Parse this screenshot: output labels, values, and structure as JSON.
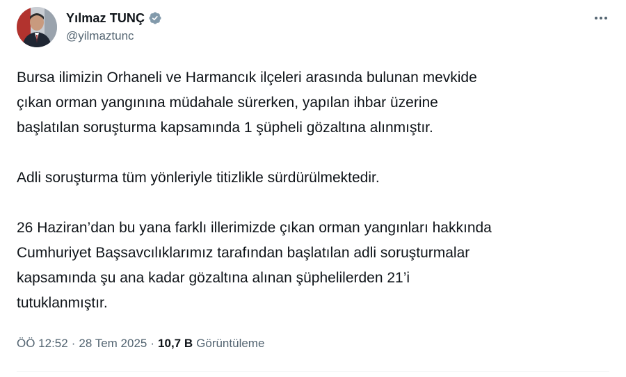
{
  "author": {
    "display_name": "Yılmaz TUNÇ",
    "handle": "@yilmaztunc",
    "verified_icon": "verified-badge-icon",
    "badge_color": "#829aab"
  },
  "menu": {
    "more_icon": "more-horizontal-icon"
  },
  "tweet": {
    "paragraphs": [
      "Bursa ilimizin Orhaneli ve Harmancık ilçeleri arasında bulunan mevkide\nçıkan orman yangınına müdahale sürerken, yapılan ihbar üzerine\nbaşlatılan soruşturma kapsamında 1 şüpheli gözaltına alınmıştır.",
      "Adli soruşturma tüm yönleriyle titizlikle sürdürülmektedir.",
      "26 Haziran’dan bu yana farklı illerimizde çıkan orman yangınları hakkında\nCumhuriyet Başsavcılıklarımız tarafından başlatılan adli soruşturmalar\nkapsamında şu ana kadar gözaltına alınan şüphelilerden 21’i\ntutuklanmıştır."
    ]
  },
  "meta": {
    "time": "ÖÖ 12:52",
    "separator": "·",
    "date": "28 Tem 2025",
    "views_count": "10,7 B",
    "views_label": "Görüntüleme"
  },
  "colors": {
    "text": "#0f1419",
    "secondary": "#536471"
  }
}
